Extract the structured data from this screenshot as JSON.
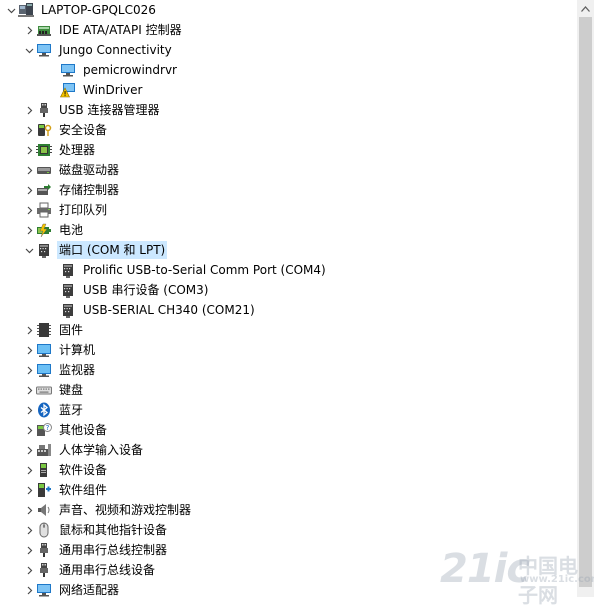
{
  "tree": {
    "root": {
      "label": "LAPTOP-GPQLC026",
      "icon": "computer-icon",
      "expanded": true
    },
    "items": [
      {
        "label": "IDE ATA/ATAPI 控制器",
        "icon": "ide-controller-icon",
        "expanded": false
      },
      {
        "label": "Jungo Connectivity",
        "icon": "network-monitor-icon",
        "expanded": true,
        "children": [
          {
            "label": "pemicrowindrvr",
            "icon": "network-monitor-icon"
          },
          {
            "label": "WinDriver",
            "icon": "warning-device-icon"
          }
        ]
      },
      {
        "label": "USB 连接器管理器",
        "icon": "usb-plug-icon",
        "expanded": false
      },
      {
        "label": "安全设备",
        "icon": "security-key-icon",
        "expanded": false
      },
      {
        "label": "处理器",
        "icon": "processor-icon",
        "expanded": false
      },
      {
        "label": "磁盘驱动器",
        "icon": "disk-drive-icon",
        "expanded": false
      },
      {
        "label": "存储控制器",
        "icon": "storage-controller-icon",
        "expanded": false
      },
      {
        "label": "打印队列",
        "icon": "printer-icon",
        "expanded": false
      },
      {
        "label": "电池",
        "icon": "battery-icon",
        "expanded": false
      },
      {
        "label": "端口 (COM 和 LPT)",
        "icon": "port-icon",
        "expanded": true,
        "selected": true,
        "children": [
          {
            "label": "Prolific USB-to-Serial Comm Port (COM4)",
            "icon": "port-icon"
          },
          {
            "label": "USB 串行设备 (COM3)",
            "icon": "port-icon"
          },
          {
            "label": "USB-SERIAL CH340 (COM21)",
            "icon": "port-icon"
          }
        ]
      },
      {
        "label": "固件",
        "icon": "firmware-icon",
        "expanded": false
      },
      {
        "label": "计算机",
        "icon": "monitor-icon",
        "expanded": false
      },
      {
        "label": "监视器",
        "icon": "monitor-icon",
        "expanded": false
      },
      {
        "label": "键盘",
        "icon": "keyboard-icon",
        "expanded": false
      },
      {
        "label": "蓝牙",
        "icon": "bluetooth-icon",
        "expanded": false
      },
      {
        "label": "其他设备",
        "icon": "unknown-device-icon",
        "expanded": false
      },
      {
        "label": "人体学输入设备",
        "icon": "hid-icon",
        "expanded": false
      },
      {
        "label": "软件设备",
        "icon": "software-device-icon",
        "expanded": false
      },
      {
        "label": "软件组件",
        "icon": "software-component-icon",
        "expanded": false
      },
      {
        "label": "声音、视频和游戏控制器",
        "icon": "speaker-icon",
        "expanded": false
      },
      {
        "label": "鼠标和其他指针设备",
        "icon": "mouse-icon",
        "expanded": false
      },
      {
        "label": "通用串行总线控制器",
        "icon": "usb-plug-icon",
        "expanded": false
      },
      {
        "label": "通用串行总线设备",
        "icon": "usb-plug-icon",
        "expanded": false
      },
      {
        "label": "网络适配器",
        "icon": "network-monitor-icon",
        "expanded": false
      }
    ]
  },
  "watermark": {
    "text": "21ic",
    "cn": "中国电子网",
    "url": "www.21ic.com"
  },
  "colors": {
    "selection": "#cce8ff",
    "scrollbar_track": "#f0f0f0",
    "scrollbar_thumb": "#cdcdcd"
  }
}
